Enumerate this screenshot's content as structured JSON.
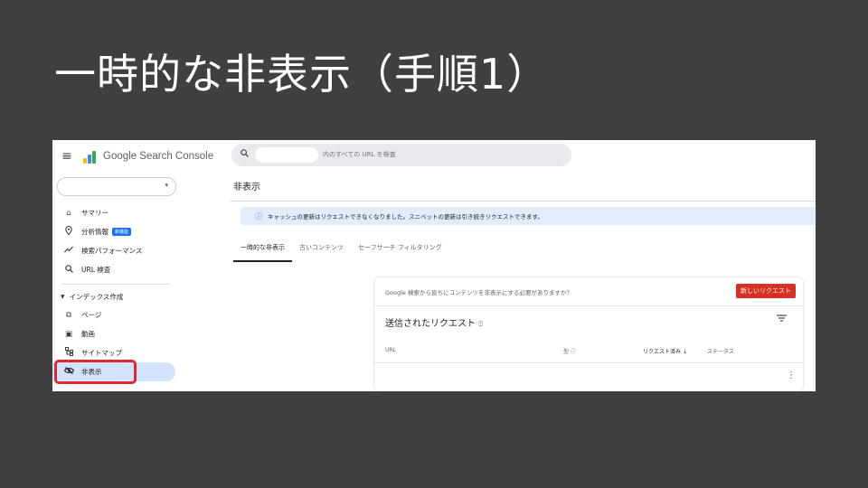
{
  "slide": {
    "title": "一時的な非表示（手順1）"
  },
  "app": {
    "name": "Google Search Console"
  },
  "property_selector": {
    "caret": "▾"
  },
  "sidebar": {
    "items": [
      {
        "label": "サマリー",
        "icon": "home-icon"
      },
      {
        "label": "分析情報",
        "icon": "location-pin-icon",
        "badge": "新機能"
      },
      {
        "label": "検索パフォーマンス",
        "icon": "trend-up-icon"
      },
      {
        "label": "URL 検査",
        "icon": "search-icon"
      }
    ],
    "section": "インデックス作成",
    "section_items": [
      {
        "label": "ページ",
        "icon": "page-copy-icon"
      },
      {
        "label": "動画",
        "icon": "video-icon"
      },
      {
        "label": "サイトマップ",
        "icon": "sitemap-icon"
      },
      {
        "label": "非表示",
        "icon": "eye-off-icon",
        "active": true
      }
    ]
  },
  "search": {
    "placeholder": "内のすべての URL を検査"
  },
  "page": {
    "title": "非表示"
  },
  "banner": {
    "text": "キャッシュの更新はリクエストできなくなりました。スニペットの更新は引き続きリクエストできます。"
  },
  "tabs": [
    "一時的な非表示",
    "古いコンテンツ",
    "セーフサーチ フィルタリング"
  ],
  "card": {
    "question": "Google 検索から直ちにコンテンツを非表示にする必要がありますか？",
    "new_request_label": "新しいリクエスト",
    "title": "送信されたリクエスト",
    "columns": [
      "URL",
      "型",
      "リクエスト済み",
      "ステータス"
    ]
  },
  "colors": {
    "highlight": "#e0282e",
    "active_nav": "#d3e3fd",
    "banner": "#e3ecfb",
    "button": "#d93025"
  }
}
